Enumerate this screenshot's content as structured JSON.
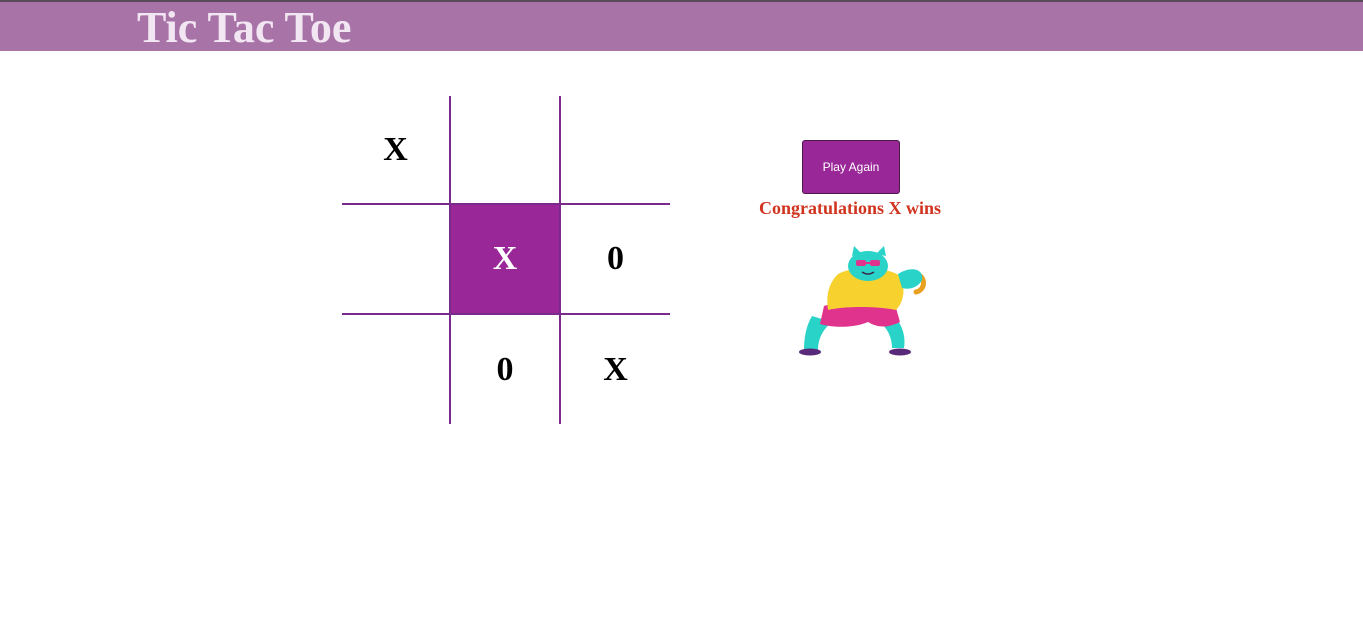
{
  "header": {
    "title": "Tic Tac Toe",
    "bg_color": "#a874a8"
  },
  "board": {
    "cells": [
      "X",
      "",
      "",
      "",
      "X",
      "0",
      "",
      "0",
      "X"
    ],
    "highlight_index": 4,
    "line_color": "#7a2a8a",
    "highlight_color": "#9a2798"
  },
  "controls": {
    "play_again_label": "Play Again"
  },
  "status": {
    "message": "Congratulations X wins",
    "color": "#d0341f"
  },
  "celebration": {
    "icon": "dancing-cat-illustration"
  }
}
